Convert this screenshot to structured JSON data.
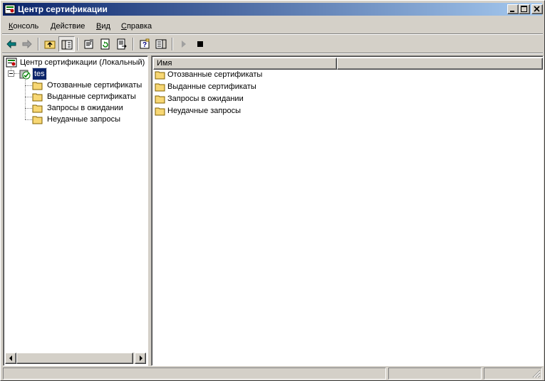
{
  "window": {
    "title": "Центр сертификации",
    "icon": "certificate-authority-icon"
  },
  "menu": [
    {
      "label": "Консоль",
      "accel": "К",
      "rest": "онсоль"
    },
    {
      "label": "Действие",
      "accel": "Д",
      "rest": "ействие"
    },
    {
      "label": "Вид",
      "accel": "В",
      "rest": "ид"
    },
    {
      "label": "Справка",
      "accel": "С",
      "rest": "правка"
    }
  ],
  "toolbar": {
    "buttons": [
      "back-icon",
      "forward-icon",
      "up-folder-icon",
      "show-hide-tree-icon",
      "properties-icon",
      "refresh-icon",
      "export-list-icon",
      "help-icon",
      "show-hide-action-pane-icon",
      "start-service-icon",
      "stop-service-icon"
    ]
  },
  "tree": {
    "root": "Центр сертификации (Локальный)",
    "ca_node": "tes",
    "children": [
      "Отозванные сертификаты",
      "Выданные сертификаты",
      "Запросы в ожидании",
      "Неудачные запросы"
    ]
  },
  "list": {
    "columns": [
      "Имя",
      ""
    ],
    "items": [
      "Отозванные сертификаты",
      "Выданные сертификаты",
      "Запросы в ожидании",
      "Неудачные запросы"
    ]
  },
  "colors": {
    "titlebar_start": "#0a246a",
    "titlebar_end": "#a6caf0",
    "face": "#d4d0c8",
    "selection": "#0a246a",
    "folder": "#f7d774"
  }
}
